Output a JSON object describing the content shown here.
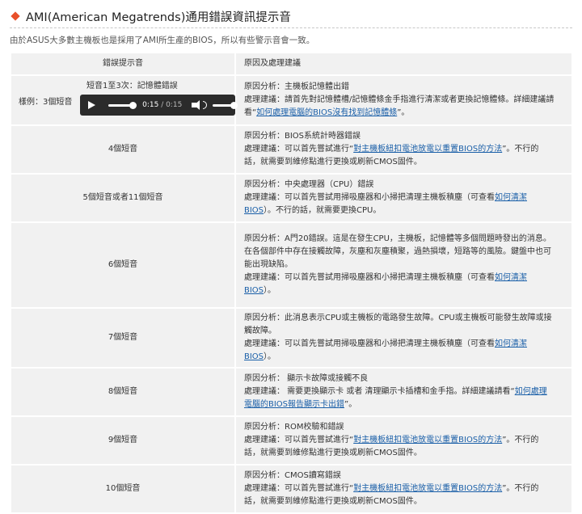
{
  "header": {
    "title": "AMI(American Megatrends)通用錯誤資訊提示音",
    "intro": "由於ASUS大多數主機板也是採用了AMI所生產的BIOS，所以有些警示音會一致。"
  },
  "table": {
    "headers": [
      "錯誤提示音",
      "原因及處理建議"
    ],
    "sample": {
      "top_text": "短音1至3次：記憶體錯誤",
      "label": "樣例：3個短音",
      "time_current": "0:15",
      "time_total": " / 0:15",
      "progress": 1.0,
      "volume": 1.0
    },
    "rows": [
      {
        "beep": "",
        "lines": [
          [
            "原因分析：主機板記憶體出錯"
          ],
          [
            "處理建議：請首先對記憶體槽/記憶體條金手指進行清潔或者更換記憶體條。詳細建議請"
          ],
          [
            "看“",
            {
              "link": "如何處理電腦的BIOS沒有找到記憶體條"
            },
            "”。"
          ]
        ]
      },
      {
        "beep": "4個短音",
        "lines": [
          [
            "原因分析：BIOS系統計時器錯誤"
          ],
          [
            "處理建議：可以首先嘗試進行“",
            {
              "link": "對主機板紐扣電池放電以重置BIOS的方法"
            },
            "”。不行的"
          ],
          [
            "話，就需要到維修點進行更換或刷新CMOS固件。"
          ]
        ]
      },
      {
        "beep": "5個短音或者11個短音",
        "lines": [
          [
            "原因分析：中央處理器（CPU）錯誤"
          ],
          [
            "處理建議：可以首先嘗試用掃吸塵器和小掃把清理主機板積塵（可查看",
            {
              "link": "如何清潔"
            }
          ],
          [
            {
              "link": "BIOS"
            },
            "）。不行的話，就需要更換CPU。"
          ]
        ]
      },
      {
        "beep": "6個短音",
        "lines": [
          [
            "原因分析：A門20錯誤。這是在發生CPU，主機板，記憶體等多個問題時發出的消息。"
          ],
          [
            "在各個部件中存在接觸故障，灰塵和灰塵積聚，過熱損壞，短路等的風險。鍵盤中也可"
          ],
          [
            "能出現缺陷。"
          ],
          [
            "處理建議：可以首先嘗試用掃吸塵器和小掃把清理主機板積塵（可查看",
            {
              "link": "如何清潔"
            }
          ],
          [
            {
              "link": "BIOS"
            },
            "）。"
          ]
        ]
      },
      {
        "beep": "7個短音",
        "lines": [
          [
            "原因分析：此消息表示CPU或主機板的電路發生故障。CPU或主機板可能發生故障或接"
          ],
          [
            "觸故障。"
          ],
          [
            "處理建議：可以首先嘗試用掃吸塵器和小掃把清理主機板積塵（可查看",
            {
              "link": "如何清潔"
            }
          ],
          [
            {
              "link": "BIOS"
            },
            "）。"
          ]
        ]
      },
      {
        "beep": "8個短音",
        "lines": [
          [
            "原因分析：  顯示卡故障或接觸不良"
          ],
          [
            "處理建議：  需要更換顯示卡 或者 清理顯示卡插槽和金手指。詳細建議請看“",
            {
              "link": "如何處理"
            }
          ],
          [
            {
              "link": "電腦的BIOS報告顯示卡出錯"
            },
            "”。"
          ]
        ]
      },
      {
        "beep": "9個短音",
        "lines": [
          [
            "原因分析：ROM校驗和錯誤"
          ],
          [
            "處理建議：可以首先嘗試進行“",
            {
              "link": "對主機板紐扣電池放電以重置BIOS的方法"
            },
            "”。不行的"
          ],
          [
            "話，就需要到維修點進行更換或刷新CMOS固件。"
          ]
        ]
      },
      {
        "beep": "10個短音",
        "lines": [
          [
            "原因分析：CMOS讀寫錯誤"
          ],
          [
            "處理建議：可以首先嘗試進行“",
            {
              "link": "對主機板紐扣電池放電以重置BIOS的方法"
            },
            "”。不行的"
          ],
          [
            "話，就需要到維修點進行更換或刷新CMOS固件。"
          ]
        ]
      }
    ]
  }
}
